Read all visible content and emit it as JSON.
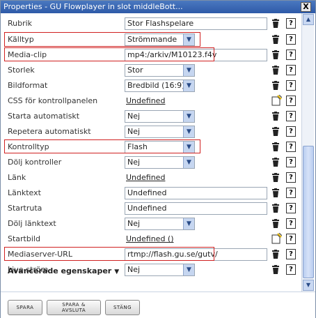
{
  "window": {
    "title": "Properties - GU Flowplayer in slot middleBott...",
    "close_label": "X"
  },
  "rows": [
    {
      "label": "Rubrik",
      "value": "Stor Flashspelare",
      "kind": "input"
    },
    {
      "label": "Källtyp",
      "value": "Strömmande",
      "kind": "select"
    },
    {
      "label": "Media-clip",
      "value": "mp4:/arkiv/M10123.f4v",
      "kind": "input"
    },
    {
      "label": "Storlek",
      "value": "Stor",
      "kind": "select"
    },
    {
      "label": "Bildformat",
      "value": "Bredbild (16:9)",
      "kind": "select"
    },
    {
      "label": "CSS för kontrollpanelen",
      "value": "Undefined",
      "kind": "link"
    },
    {
      "label": "Starta automatiskt",
      "value": "Nej",
      "kind": "select"
    },
    {
      "label": "Repetera automatiskt",
      "value": "Nej",
      "kind": "select"
    },
    {
      "label": "Kontrolltyp",
      "value": "Flash",
      "kind": "select"
    },
    {
      "label": "Dölj kontroller",
      "value": "Nej",
      "kind": "select"
    },
    {
      "label": "Länk",
      "value": "Undefined",
      "kind": "link"
    },
    {
      "label": "Länktext",
      "value": "Undefined",
      "kind": "input"
    },
    {
      "label": "Startruta",
      "value": "Undefined",
      "kind": "input"
    },
    {
      "label": "Dölj länktext",
      "value": "Nej",
      "kind": "select"
    },
    {
      "label": "Startbild",
      "value": "Undefined ()",
      "kind": "link"
    },
    {
      "label": "Mediaserver-URL",
      "value": "rtmp://flash.gu.se/gutv/",
      "kind": "input"
    },
    {
      "label": "Live-ström",
      "value": "Nej",
      "kind": "select"
    }
  ],
  "advanced_label": "Avancerade egenskaper",
  "help_label": "?",
  "buttons": {
    "save": "SPARA",
    "save_close_line1": "SPARA &",
    "save_close_line2": "AVSLUTA",
    "close": "STÄNG"
  },
  "colors": {
    "highlight": "#d02020",
    "titlebar": "#2e5aa8"
  }
}
